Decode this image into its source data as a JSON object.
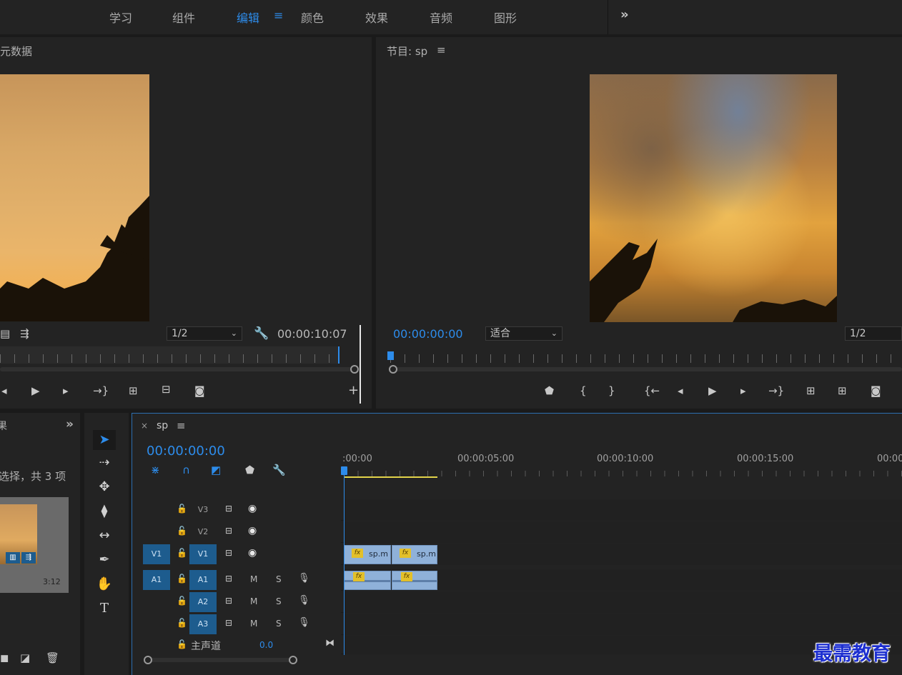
{
  "workspaces": {
    "items": [
      "学习",
      "组件",
      "编辑",
      "颜色",
      "效果",
      "音频",
      "图形"
    ],
    "active": "编辑",
    "more_icon": "double-chevron-right-icon"
  },
  "source_monitor": {
    "title": "元数据",
    "resolution": "1/2",
    "timecode": "00:00:10:07"
  },
  "program_monitor": {
    "title": "节目: sp",
    "timecode": "00:00:00:00",
    "zoom": "适合",
    "resolution": "1/2"
  },
  "project_panel": {
    "tab_partial": "果",
    "status": "选择，共 3 项",
    "thumb_duration": "3:12"
  },
  "timeline": {
    "sequence_name": "sp",
    "timecode": "00:00:00:00",
    "ruler_labels": [
      ":00:00",
      "00:00:05:00",
      "00:00:10:00",
      "00:00:15:00",
      "00:00"
    ],
    "tracks": {
      "v3": "V3",
      "v2": "V2",
      "v1_src": "V1",
      "v1": "V1",
      "a1_src": "A1",
      "a1": "A1",
      "a2": "A2",
      "a3": "A3",
      "mute": "M",
      "solo": "S",
      "master_label": "主声道",
      "master_value": "0.0"
    },
    "clips": [
      {
        "name": "sp.m",
        "fx": "fx"
      },
      {
        "name": "sp.m",
        "fx": "fx"
      }
    ],
    "audio_fx": [
      "fx",
      "fx"
    ]
  },
  "watermark": "最需教育",
  "colors": {
    "accent": "#2d8ceb",
    "panel": "#232323",
    "clip_video": "#8fb1d9",
    "fx_badge": "#e3c02a",
    "work_area": "#e2d34a"
  }
}
